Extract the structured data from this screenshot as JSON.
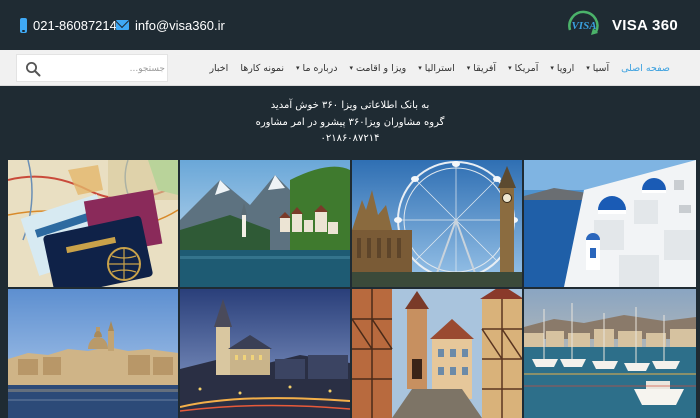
{
  "header": {
    "phone": "021-86087214",
    "email": "info@visa360.ir",
    "brand": "VISA 360",
    "logo_mark": "VISA"
  },
  "nav": {
    "items": [
      {
        "label": "صفحه اصلی",
        "dropdown": false,
        "active": true
      },
      {
        "label": "آسیا",
        "dropdown": true,
        "active": false
      },
      {
        "label": "اروپا",
        "dropdown": true,
        "active": false
      },
      {
        "label": "آمریکا",
        "dropdown": true,
        "active": false
      },
      {
        "label": "آفریقا",
        "dropdown": true,
        "active": false
      },
      {
        "label": "استرالیا",
        "dropdown": true,
        "active": false
      },
      {
        "label": "ویزا و اقامت",
        "dropdown": true,
        "active": false
      },
      {
        "label": "درباره ما",
        "dropdown": true,
        "active": false
      },
      {
        "label": "نمونه کارها",
        "dropdown": false,
        "active": false
      },
      {
        "label": "اخبار",
        "dropdown": false,
        "active": false
      }
    ],
    "search_placeholder": "جستجو..."
  },
  "welcome": {
    "line1": "به بانک اطلاعاتی ویزا ۳۶۰ خوش آمدید",
    "line2": "گروه مشاوران ویزا۳۶۰ پیشرو در امر مشاوره",
    "line3": "۰۲۱۸۶۰۸۷۲۱۴"
  },
  "tiles": [
    {
      "subject": "passport-and-map"
    },
    {
      "subject": "alpine-lake-village"
    },
    {
      "subject": "london-eye-big-ben"
    },
    {
      "subject": "santorini-blue-domes"
    },
    {
      "subject": "malta-harbor-skyline"
    },
    {
      "subject": "old-town-church-night"
    },
    {
      "subject": "half-timbered-street"
    },
    {
      "subject": "harbor-boats"
    }
  ],
  "colors": {
    "background": "#1f2b33",
    "accent": "#3aa0df",
    "nav_background": "#f1f1f1",
    "icon_blue": "#3fa9f5"
  }
}
